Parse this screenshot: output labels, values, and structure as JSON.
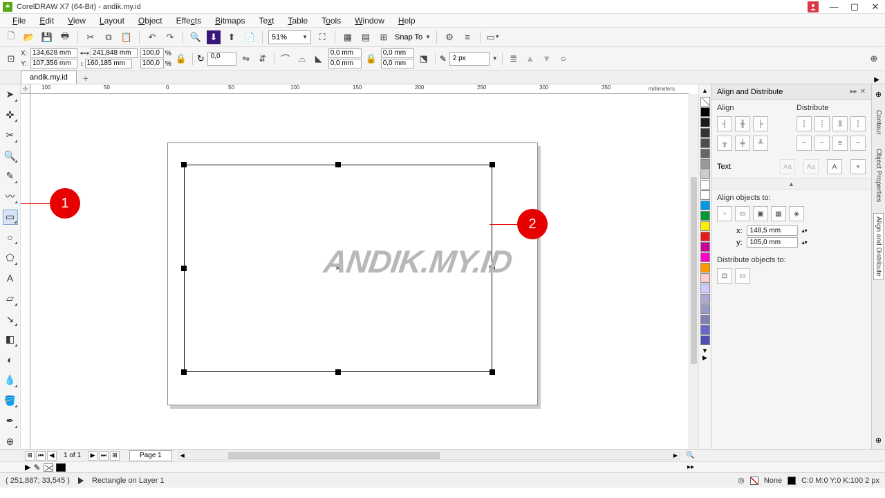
{
  "title": "CorelDRAW X7 (64-Bit) - andik.my.id",
  "menus": [
    "File",
    "Edit",
    "View",
    "Layout",
    "Object",
    "Effects",
    "Bitmaps",
    "Text",
    "Table",
    "Tools",
    "Window",
    "Help"
  ],
  "toolbar1": {
    "zoom": "51%",
    "snap": "Snap To"
  },
  "position": {
    "x_label": "X:",
    "x": "134,628 mm",
    "y_label": "Y:",
    "y": "107,356 mm"
  },
  "size": {
    "w": "241,848 mm",
    "h": "160,185 mm"
  },
  "scale": {
    "x": "100,0",
    "y": "100,0",
    "unit": "%"
  },
  "rotation": "0,0",
  "corner": {
    "x": "0,0 mm",
    "y": "0,0 mm"
  },
  "corner2": {
    "x": "0,0 mm",
    "y": "0,0 mm"
  },
  "outline": "2 px",
  "doc_tab": "andik.my.id",
  "ruler_marks": [
    "100",
    "50",
    "0",
    "50",
    "100",
    "150",
    "200",
    "250",
    "300",
    "350"
  ],
  "ruler_unit": "millimeters",
  "watermark": "ANDIK.MY.ID",
  "callouts": {
    "one": "1",
    "two": "2"
  },
  "docker": {
    "title": "Align and Distribute",
    "align": "Align",
    "distribute": "Distribute",
    "text": "Text",
    "align_to": "Align objects to:",
    "x_lbl": "x:",
    "x_val": "148,5 mm",
    "y_lbl": "y:",
    "y_val": "105,0 mm",
    "dist_to": "Distribute objects to:",
    "tabs": [
      "Contour",
      "Object Properties",
      "Align and Distribute"
    ]
  },
  "palette": [
    "#000000",
    "#1a1a1a",
    "#333333",
    "#4d4d4d",
    "#666666",
    "#999999",
    "#cccccc",
    "#ffffff",
    "#ffffff",
    "#0099e6",
    "#009933",
    "#ffee00",
    "#e61a1a",
    "#cc0099",
    "#ff00cc",
    "#ff9900",
    "#ffcccc",
    "#ccccff",
    "#b3a6d9",
    "#9999cc",
    "#8080b3",
    "#6666cc",
    "#4d4db3"
  ],
  "page_nav": {
    "label": "1 of 1",
    "tab": "Page 1"
  },
  "status": {
    "coords": "( 251,887; 33,545 )",
    "object": "Rectangle on Layer 1",
    "fill": "None",
    "outline_info": "C:0 M:0 Y:0 K:100  2 px"
  }
}
